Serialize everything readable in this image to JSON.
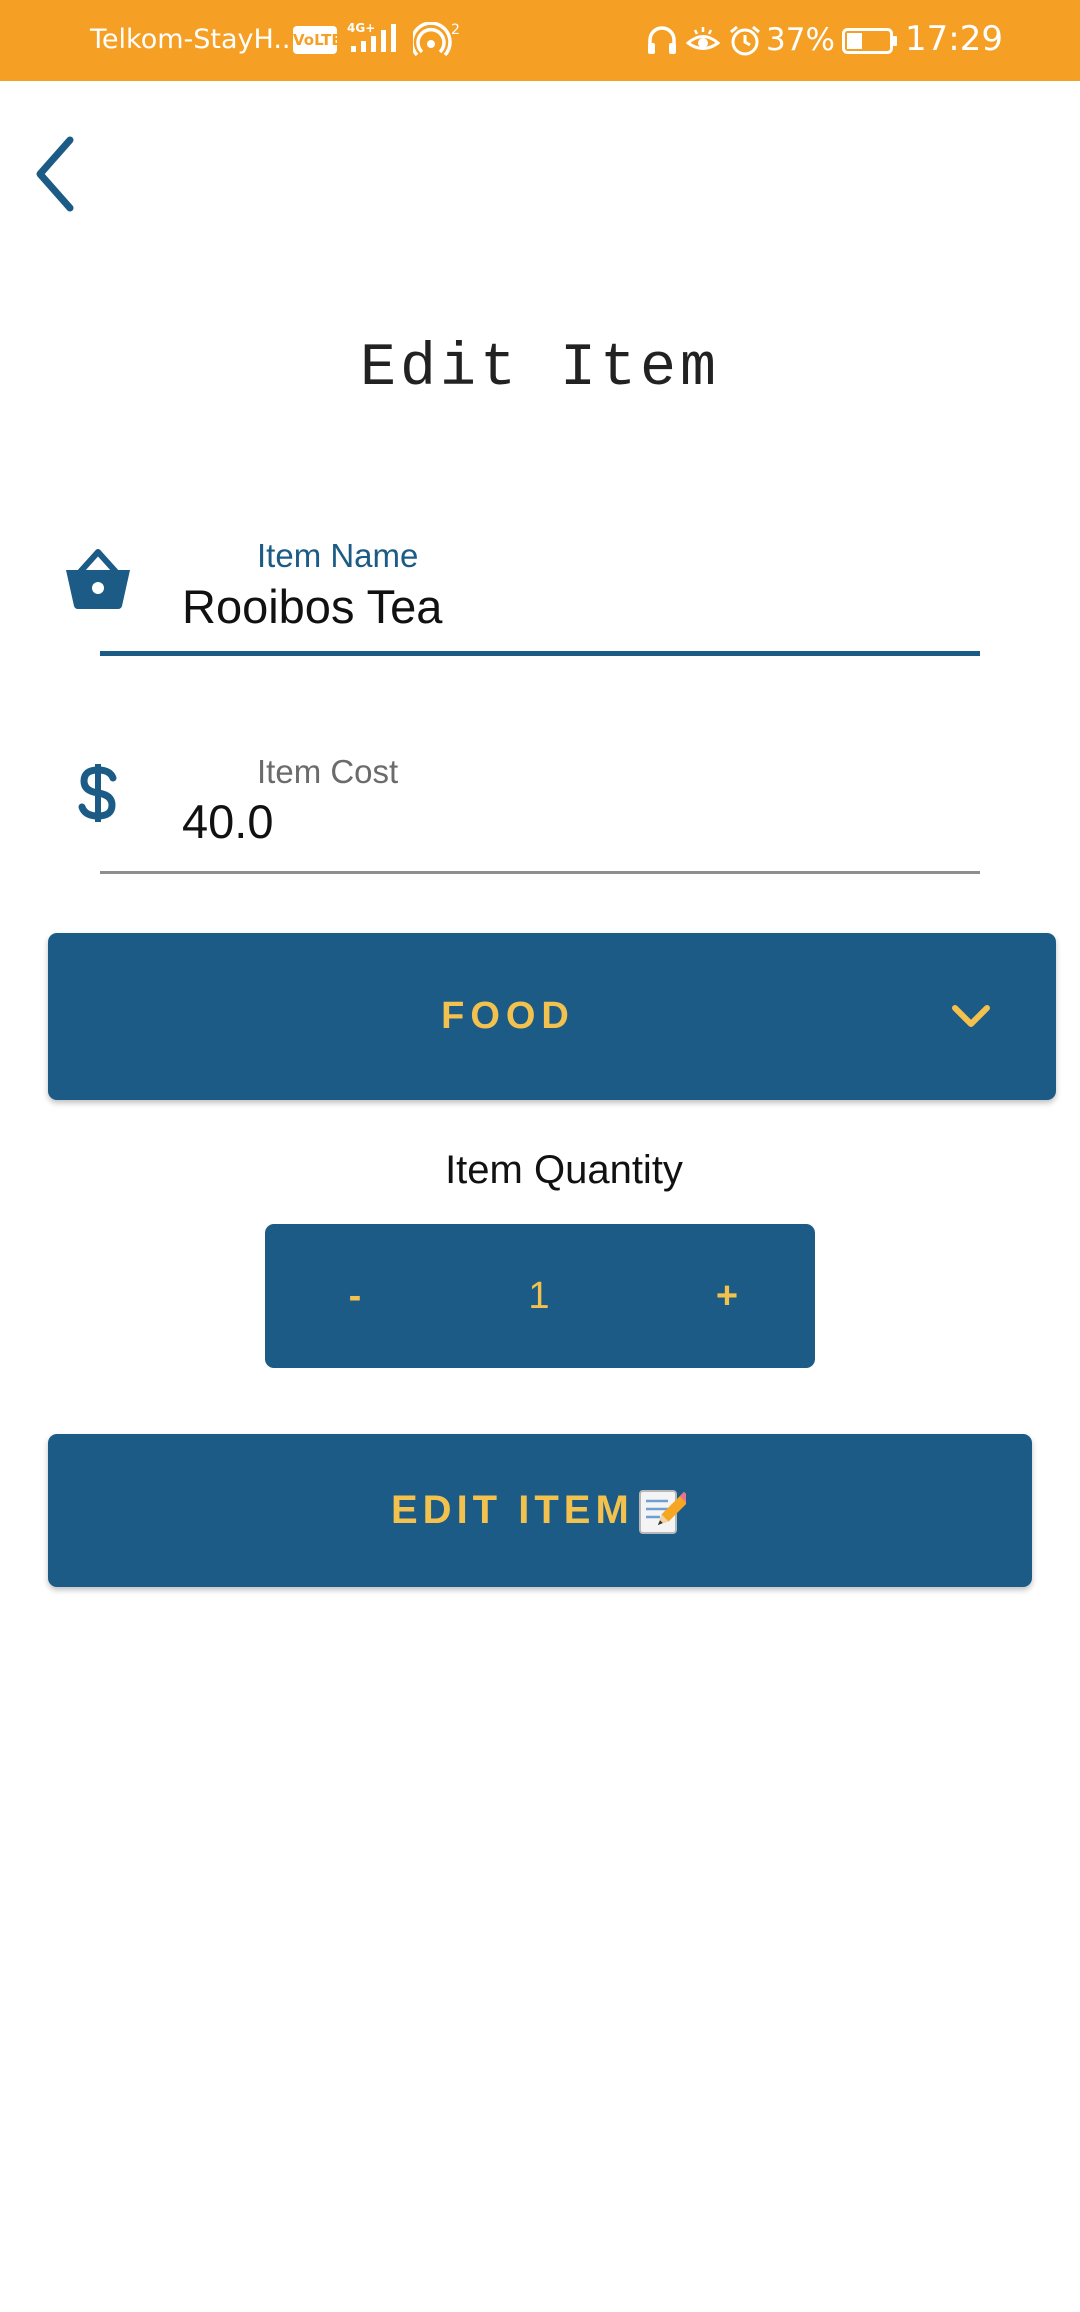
{
  "status_bar": {
    "carrier": "Telkom-StayH...",
    "volte": "VoLTE",
    "network": "4G+",
    "hotspot_count": "2",
    "battery_percent": "37%",
    "battery_level": 0.37,
    "time": "17:29",
    "icons": [
      "headphones-icon",
      "eye-comfort-icon",
      "alarm-icon"
    ]
  },
  "nav": {
    "back_icon": "chevron-left-icon"
  },
  "page": {
    "title": "Edit Item"
  },
  "item_name": {
    "label": "Item Name",
    "value": "Rooibos Tea",
    "icon": "basket-icon"
  },
  "item_cost": {
    "label": "Item Cost",
    "value": "40.0",
    "icon": "dollar-icon"
  },
  "category": {
    "selected": "FOOD",
    "icon": "chevron-down-icon"
  },
  "quantity": {
    "label": "Item Quantity",
    "decrement": "-",
    "value": "1",
    "increment": "+"
  },
  "submit": {
    "label": "EDIT ITEM",
    "icon": "memo-icon"
  },
  "colors": {
    "status_bar": "#F5A025",
    "primary": "#1B5B85",
    "accent_text": "#F2C14E",
    "label_active": "#1B5B85",
    "label_inactive": "#6b6b6b"
  }
}
